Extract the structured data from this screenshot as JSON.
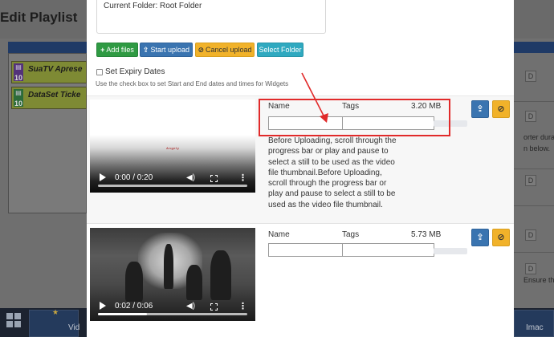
{
  "background": {
    "page_title": "Edit Playlist",
    "items": [
      {
        "name": "SuaTV Aprese",
        "number": "10"
      },
      {
        "name": "DataSet Ticke",
        "number": "10"
      }
    ],
    "right_fragments": [
      "orter dura",
      "n below.",
      "Ensure th"
    ],
    "right_markers": [
      "D",
      "D",
      "D",
      "D",
      "D"
    ],
    "footer_tiles": [
      "Vid",
      "Imac"
    ]
  },
  "modal": {
    "current_folder": "Current Folder: Root Folder",
    "buttons": {
      "add_files": "Add files",
      "start_upload": "Start upload",
      "cancel_upload": "Cancel upload",
      "select_folder": "Select Folder"
    },
    "expiry": {
      "label": "Set Expiry Dates",
      "checked": false,
      "help": "Use the check box to set Start and End dates and times for Widgets"
    },
    "files": [
      {
        "name_header": "Name",
        "tags_header": "Tags",
        "size": "3.20 MB",
        "name_value": "",
        "tags_value": "",
        "video_time": "0:00 / 0:20",
        "video_progress": 0.0,
        "video_logo": "Angely",
        "upload_progress": 0.0,
        "description": "Before Uploading, scroll through the progress bar or play and pause to select a still to be used as the video file thumbnail.Before Uploading, scroll through the progress bar or play and pause to select a still to be used as the video file thumbnail."
      },
      {
        "name_header": "Name",
        "tags_header": "Tags",
        "size": "5.73 MB",
        "name_value": "",
        "tags_value": "",
        "video_time": "0:02 / 0:06",
        "video_progress": 0.33,
        "upload_progress": 0.0
      }
    ]
  },
  "colors": {
    "success": "#2f9a43",
    "primary": "#3a74b0",
    "warning": "#f1b22a",
    "info": "#2fa9c0",
    "highlight": "#e12a2a"
  },
  "icons": {
    "add": "plus-icon",
    "upload": "upload-icon",
    "cancel": "ban-icon",
    "play": "play-icon",
    "volume": "volume-icon",
    "fullscreen": "fullscreen-icon",
    "more": "more-vertical-icon",
    "grid": "grid-icon"
  }
}
